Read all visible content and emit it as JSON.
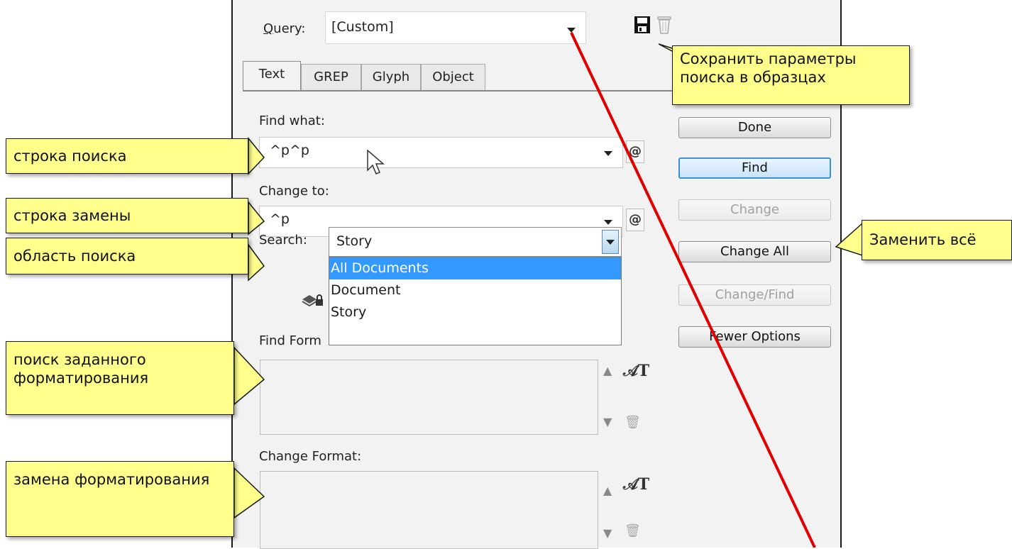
{
  "dialog": {
    "query_label": "Query:",
    "query_value": "[Custom]",
    "save_icon": "floppy-disk-icon",
    "delete_icon": "trash-icon",
    "tabs": [
      {
        "label": "Text",
        "active": true
      },
      {
        "label": "GREP",
        "active": false
      },
      {
        "label": "Glyph",
        "active": false
      },
      {
        "label": "Object",
        "active": false
      }
    ],
    "find_what_label": "Find what:",
    "find_what_value": "^p^p",
    "change_to_label": "Change to:",
    "change_to_value": "^p",
    "search_label": "Search:",
    "search_value": "Story",
    "search_options": [
      "All Documents",
      "Document",
      "Story"
    ],
    "find_format_label": "Find Form",
    "change_format_label": "Change Format:",
    "special_char_icon": "@",
    "buttons": {
      "done": "Done",
      "find": "Find",
      "change": "Change",
      "change_all": "Change All",
      "change_find": "Change/Find",
      "fewer_options": "Fewer Options"
    }
  },
  "callouts": {
    "save_query": "Сохранить параметры поиска в образцах",
    "change_all": "Заменить всё",
    "find_string": "строка поиска",
    "change_string": "строка замены",
    "search_scope": "область поиска",
    "find_format": "поиск заданного форматирования",
    "change_format": "замена форматирования"
  },
  "colors": {
    "callout_fill": "#ffff8c",
    "selection": "#3399ff",
    "annotation_line": "#e00000"
  }
}
